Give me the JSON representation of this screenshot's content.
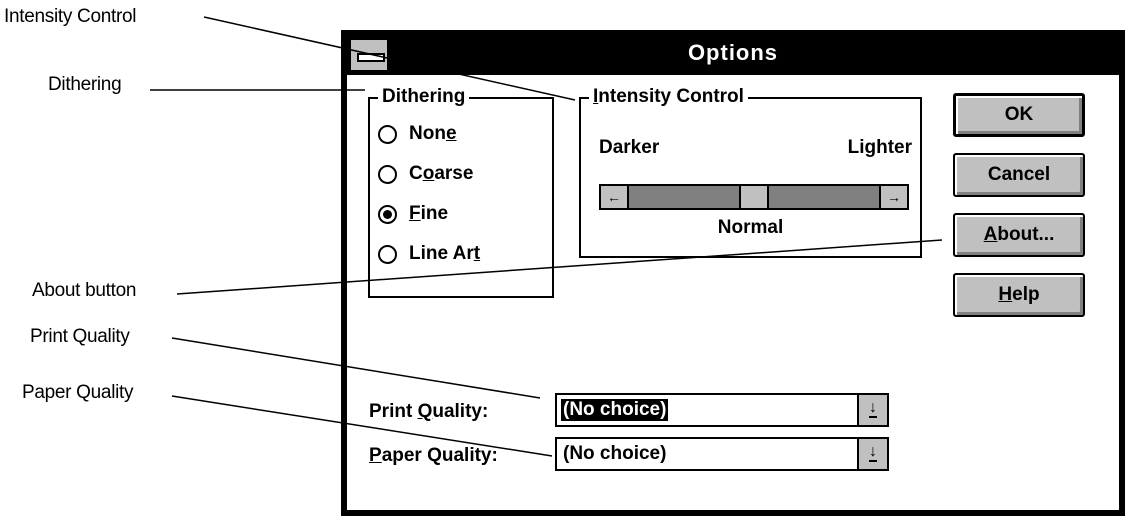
{
  "callouts": {
    "intensity_control": "Intensity Control",
    "dithering": "Dithering",
    "about_button": "About button",
    "print_quality": "Print Quality",
    "paper_quality": "Paper Quality"
  },
  "dialog": {
    "title": "Options",
    "dithering": {
      "title": "Dithering",
      "options": [
        {
          "pre": "Non",
          "key": "e",
          "post": "",
          "checked": false
        },
        {
          "pre": "C",
          "key": "o",
          "post": "arse",
          "checked": false
        },
        {
          "pre": "",
          "key": "F",
          "post": "ine",
          "checked": true
        },
        {
          "pre": "Line Ar",
          "key": "t",
          "post": "",
          "checked": false
        }
      ]
    },
    "intensity": {
      "title_key": "I",
      "title_rest": "ntensity Control",
      "darker": "Darker",
      "lighter": "Lighter",
      "value_label": "Normal",
      "slider_level": 0.5,
      "left_arrow": "←",
      "right_arrow": "→"
    },
    "buttons": {
      "ok": "OK",
      "cancel": "Cancel",
      "about_key": "A",
      "about_rest": "bout...",
      "help_key": "H",
      "help_rest": "elp"
    },
    "print_quality": {
      "label_pre": "Print ",
      "label_key": "Q",
      "label_post": "uality:",
      "value": "(No choice)"
    },
    "paper_quality": {
      "label_key": "P",
      "label_post": "aper Quality:",
      "value": "(No choice)"
    },
    "combo_arrow": "↓"
  }
}
